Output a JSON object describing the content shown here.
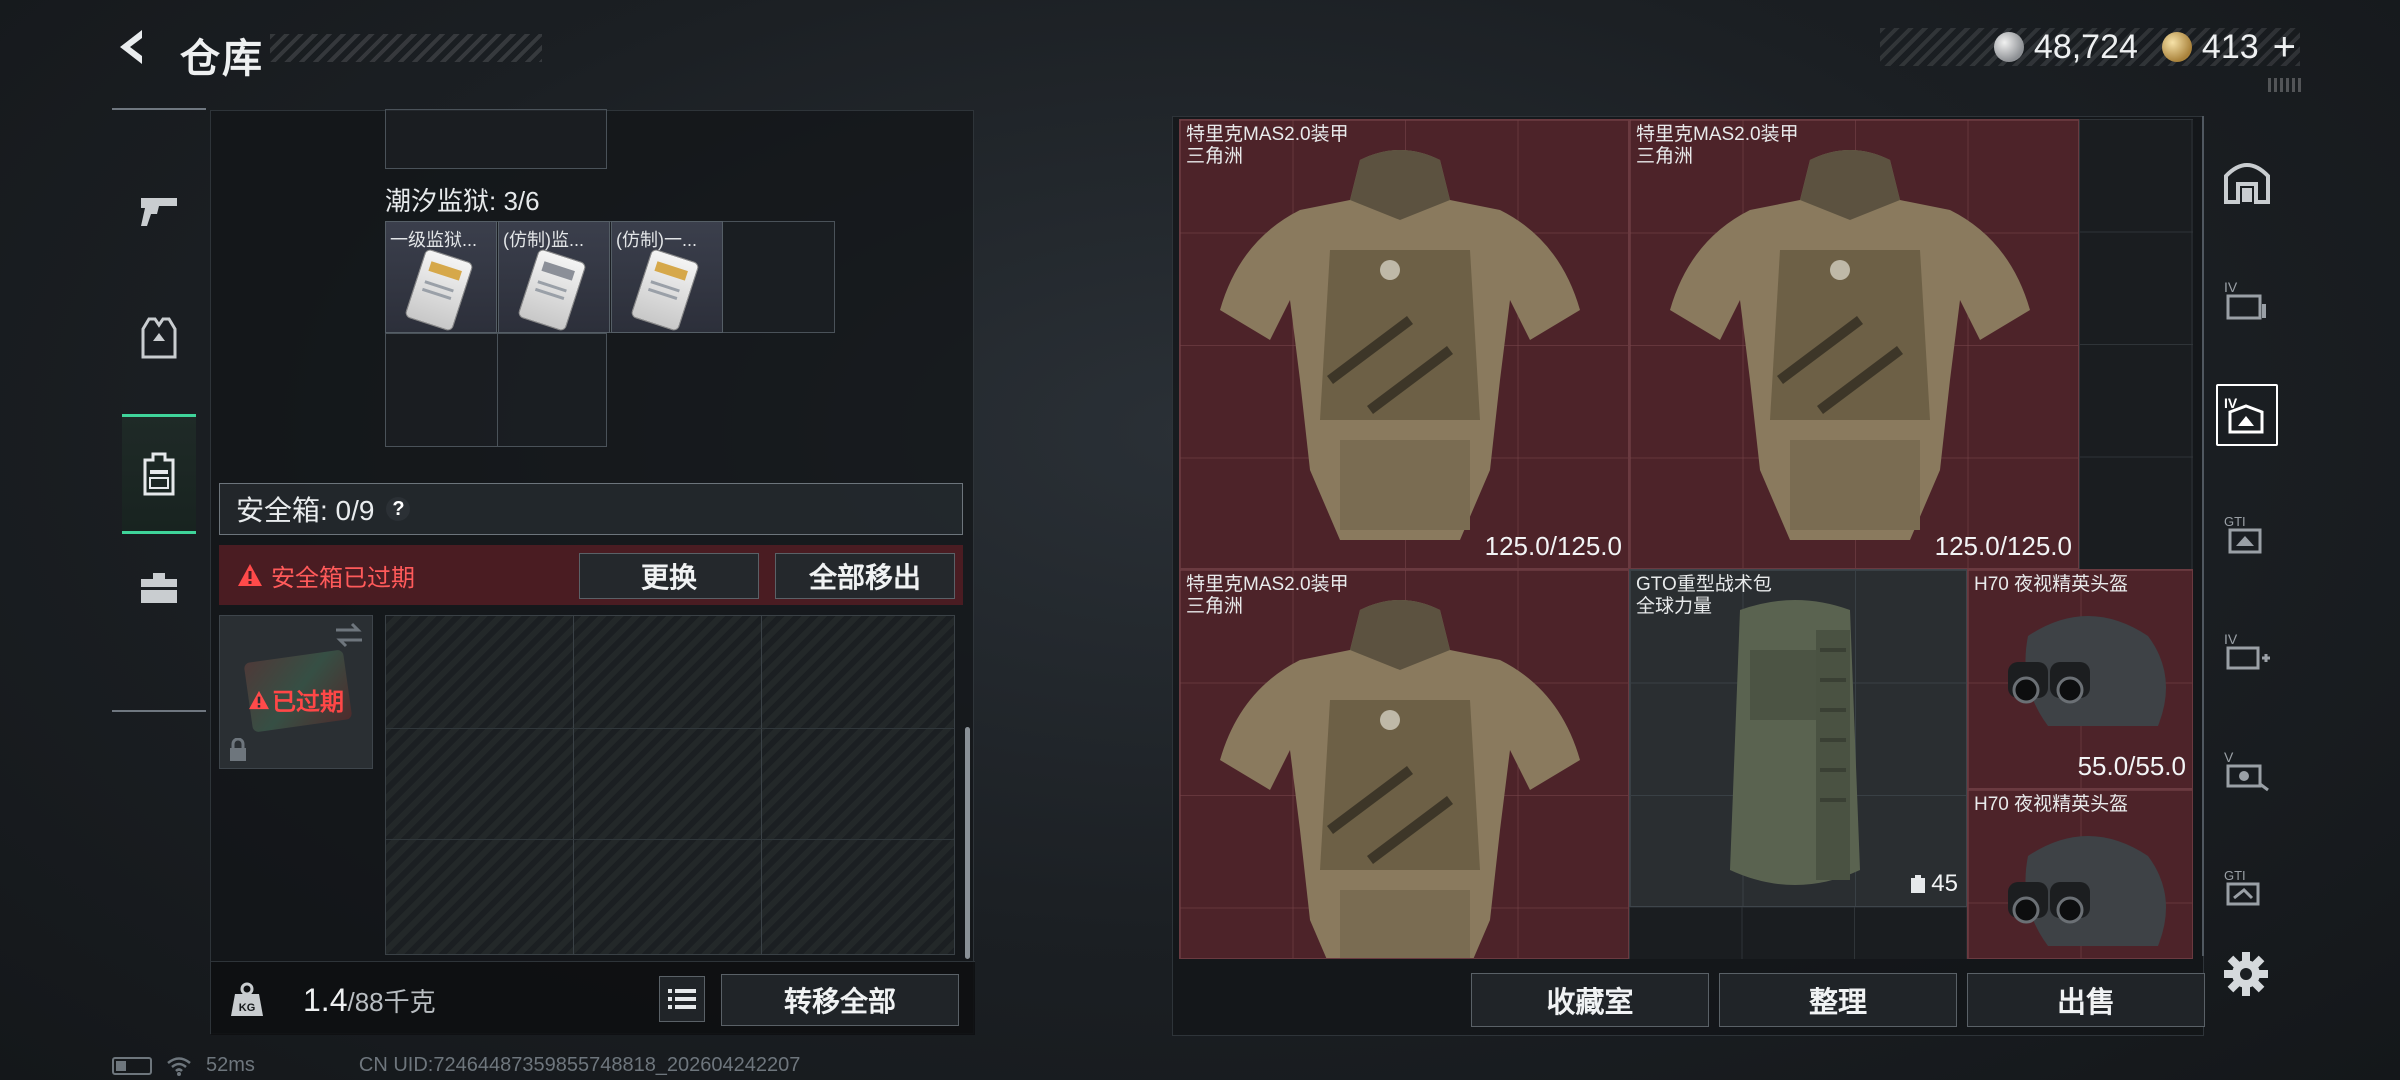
{
  "header": {
    "title": "仓库",
    "currency": [
      {
        "icon": "silver-coin-icon",
        "value": "48,724"
      },
      {
        "icon": "gold-coin-icon",
        "value": "413"
      }
    ],
    "add_label": "+"
  },
  "left_panel": {
    "prison_label": "潮汐监狱: 3/6",
    "keycards": [
      {
        "name": "一级监狱..."
      },
      {
        "name": "(仿制)监..."
      },
      {
        "name": "(仿制)一..."
      }
    ],
    "safe_box_label": "安全箱: 0/9",
    "help_label": "?",
    "expired_notice": "安全箱已过期",
    "replace_label": "更换",
    "move_all_out_label": "全部移出",
    "expired_badge": "已过期",
    "weight_value": "1.4",
    "weight_max": "/88千克",
    "kg_icon_label": "KG",
    "transfer_all_label": "转移全部"
  },
  "stash": {
    "items": [
      {
        "name": "特里克MAS2.0装甲",
        "sub": "三角洲",
        "durability": "125.0/125.0"
      },
      {
        "name": "特里克MAS2.0装甲",
        "sub": "三角洲",
        "durability": "125.0/125.0"
      },
      {
        "name": "特里克MAS2.0装甲",
        "sub": "三角洲",
        "durability": ""
      },
      {
        "name": "GTO重型战术包",
        "sub": "全球力量",
        "capacity": "45"
      },
      {
        "name": "H70 夜视精英头盔",
        "sub": "",
        "durability": "55.0/55.0"
      },
      {
        "name": "H70 夜视精英头盔",
        "sub": "",
        "durability": ""
      }
    ],
    "buttons": {
      "collection": "收藏室",
      "organize": "整理",
      "sell": "出售"
    }
  },
  "right_rail": [
    {
      "label": ""
    },
    {
      "label": "IV"
    },
    {
      "label": "IV"
    },
    {
      "label": "GTI"
    },
    {
      "label": "IV"
    },
    {
      "label": "V"
    },
    {
      "label": "GTI"
    }
  ],
  "status": {
    "ping": "52ms",
    "uid": "CN UID:72464487359855748818_202604242207"
  },
  "colors": {
    "accent": "#3fd49a",
    "danger": "#ff4a4a",
    "armor_slot": "#4d2329"
  }
}
